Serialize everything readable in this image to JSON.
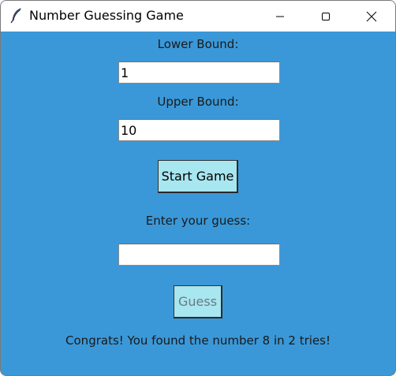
{
  "window": {
    "title": "Number Guessing Game",
    "app_icon": "feather-icon",
    "controls": {
      "minimize_icon": "minimize-icon",
      "maximize_icon": "maximize-icon",
      "close_icon": "close-icon"
    }
  },
  "colors": {
    "background": "#3a98d8",
    "button": "#a8e6f0",
    "disabled_text": "#6c7a80"
  },
  "form": {
    "lower_label": "Lower Bound:",
    "lower_value": "1",
    "upper_label": "Upper Bound:",
    "upper_value": "10",
    "start_button": "Start Game",
    "guess_label": "Enter your guess:",
    "guess_value": "",
    "guess_button": "Guess",
    "guess_button_state": "disabled",
    "result": "Congrats! You found the number 8 in 2 tries!"
  }
}
